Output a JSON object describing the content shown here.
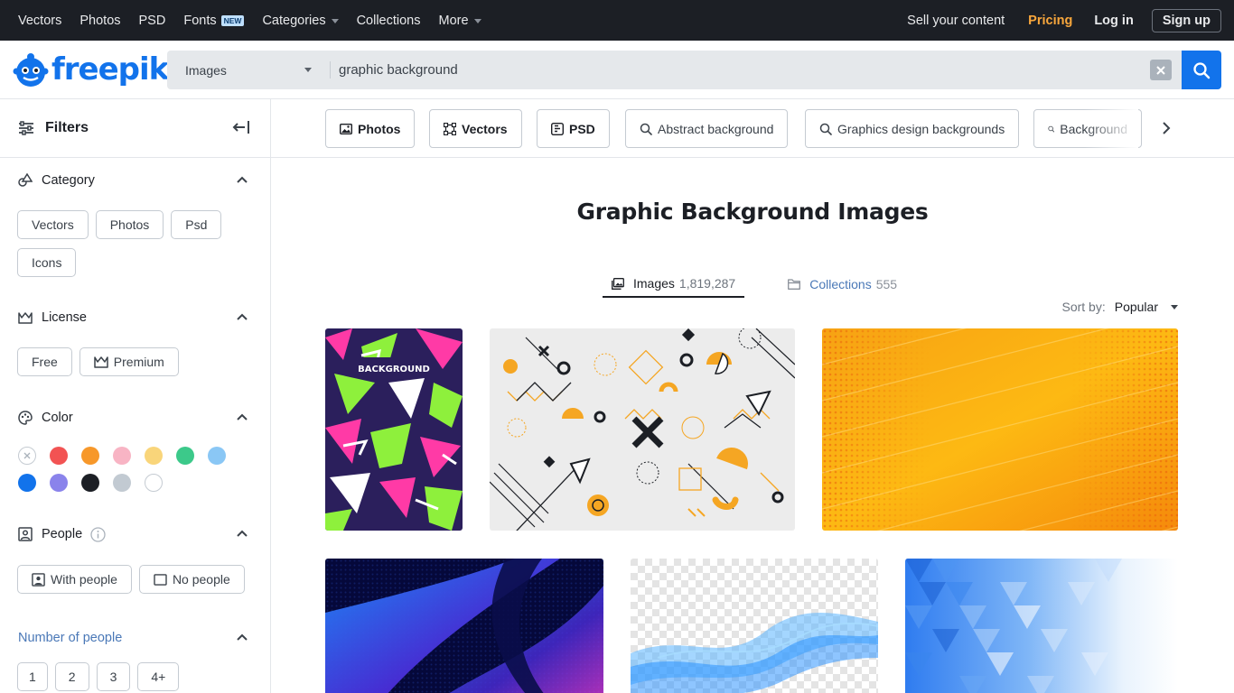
{
  "topnav": {
    "items": [
      {
        "label": "Vectors"
      },
      {
        "label": "Photos"
      },
      {
        "label": "PSD"
      },
      {
        "label": "Fonts",
        "badge": "NEW"
      },
      {
        "label": "Categories",
        "dropdown": true
      },
      {
        "label": "Collections"
      },
      {
        "label": "More",
        "dropdown": true
      }
    ],
    "sell": "Sell your content",
    "pricing": "Pricing",
    "login": "Log in",
    "signup": "Sign up"
  },
  "logo": {
    "text": "freepik"
  },
  "search": {
    "type": "Images",
    "value": "graphic background"
  },
  "sidebar": {
    "title": "Filters",
    "category": {
      "label": "Category",
      "chips": [
        "Vectors",
        "Photos",
        "Psd",
        "Icons"
      ]
    },
    "license": {
      "label": "License",
      "free": "Free",
      "premium": "Premium"
    },
    "color": {
      "label": "Color",
      "swatches": [
        "#ffffff",
        "#f25353",
        "#f7982a",
        "#f8b4c4",
        "#f9d57a",
        "#3cc98a",
        "#8ac7f5",
        "#1273eb",
        "#8a83eb",
        "#1c1f25",
        "#c2cad2",
        "#ffffff"
      ]
    },
    "people": {
      "label": "People",
      "with": "With people",
      "without": "No people"
    },
    "number_of_people": {
      "label": "Number of people",
      "chips": [
        "1",
        "2",
        "3",
        "4+"
      ]
    }
  },
  "related": [
    {
      "label": "Photos",
      "icon": "image-icon"
    },
    {
      "label": "Vectors",
      "icon": "vector-icon"
    },
    {
      "label": "PSD",
      "icon": "psd-icon"
    },
    {
      "label": "Abstract background",
      "icon": "search-icon"
    },
    {
      "label": "Graphics design backgrounds",
      "icon": "search-icon"
    },
    {
      "label": "Background",
      "icon": "search-icon"
    }
  ],
  "page_title": "Graphic Background Images",
  "tabs": {
    "images": {
      "label": "Images",
      "count": "1,819,287"
    },
    "collections": {
      "label": "Collections",
      "count": "555"
    }
  },
  "sort": {
    "label": "Sort by:",
    "value": "Popular"
  },
  "thumbs": {
    "t1_text": "BACKGROUND"
  },
  "colors": {
    "accent": "#1273eb",
    "nav_bg": "#1c1f25",
    "pricing": "#f9a73c"
  }
}
